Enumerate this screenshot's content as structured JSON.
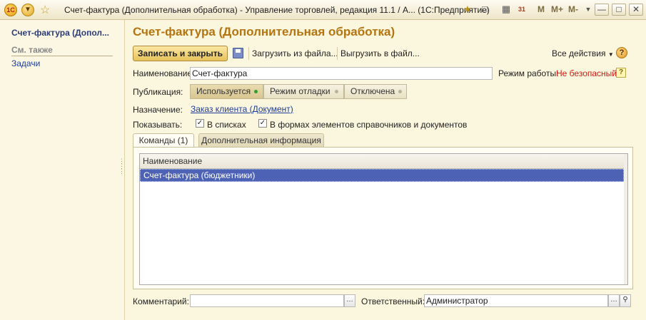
{
  "window": {
    "title": "Счет-фактура (Дополнительная обработка) - Управление торговлей, редакция 11.1 / А...  (1С:Предприятие)",
    "logo_text": "1С",
    "m_buttons": [
      "M",
      "M+",
      "M-"
    ],
    "calendar_day": "31"
  },
  "sidebar": {
    "title": "Счет-фактура (Допол...",
    "section": "См. также",
    "items": [
      {
        "label": "Задачи"
      }
    ]
  },
  "form": {
    "title": "Счет-фактура (Дополнительная обработка)",
    "toolbar": {
      "save_close": "Записать и закрыть",
      "load": "Загрузить из файла...",
      "unload": "Выгрузить в файл...",
      "all_actions": "Все действия",
      "help": "?"
    },
    "name_label": "Наименование:",
    "name_value": "Счет-фактура",
    "mode_label": "Режим работы:",
    "mode_value": "Не безопасный",
    "mode_help": "?",
    "publication_label": "Публикация:",
    "publication_options": [
      "Используется",
      "Режим отладки",
      "Отключена"
    ],
    "publication_selected": "Используется",
    "purpose_label": "Назначение:",
    "purpose_value": "Заказ клиента (Документ)",
    "show_label": "Показывать:",
    "show_in_lists": "В списках",
    "show_in_forms": "В формах элементов справочников и документов",
    "show_in_lists_checked": true,
    "show_in_forms_checked": true,
    "tabs": [
      {
        "label": "Команды (1)",
        "active": true
      },
      {
        "label": "Дополнительная информация",
        "active": false
      }
    ],
    "commands_table": {
      "columns": [
        "Наименование"
      ],
      "rows": [
        [
          "Счет-фактура (бюджетники)"
        ]
      ]
    },
    "comment_label": "Комментарий:",
    "comment_value": "",
    "responsible_label": "Ответственный:",
    "responsible_value": "Администратор"
  }
}
